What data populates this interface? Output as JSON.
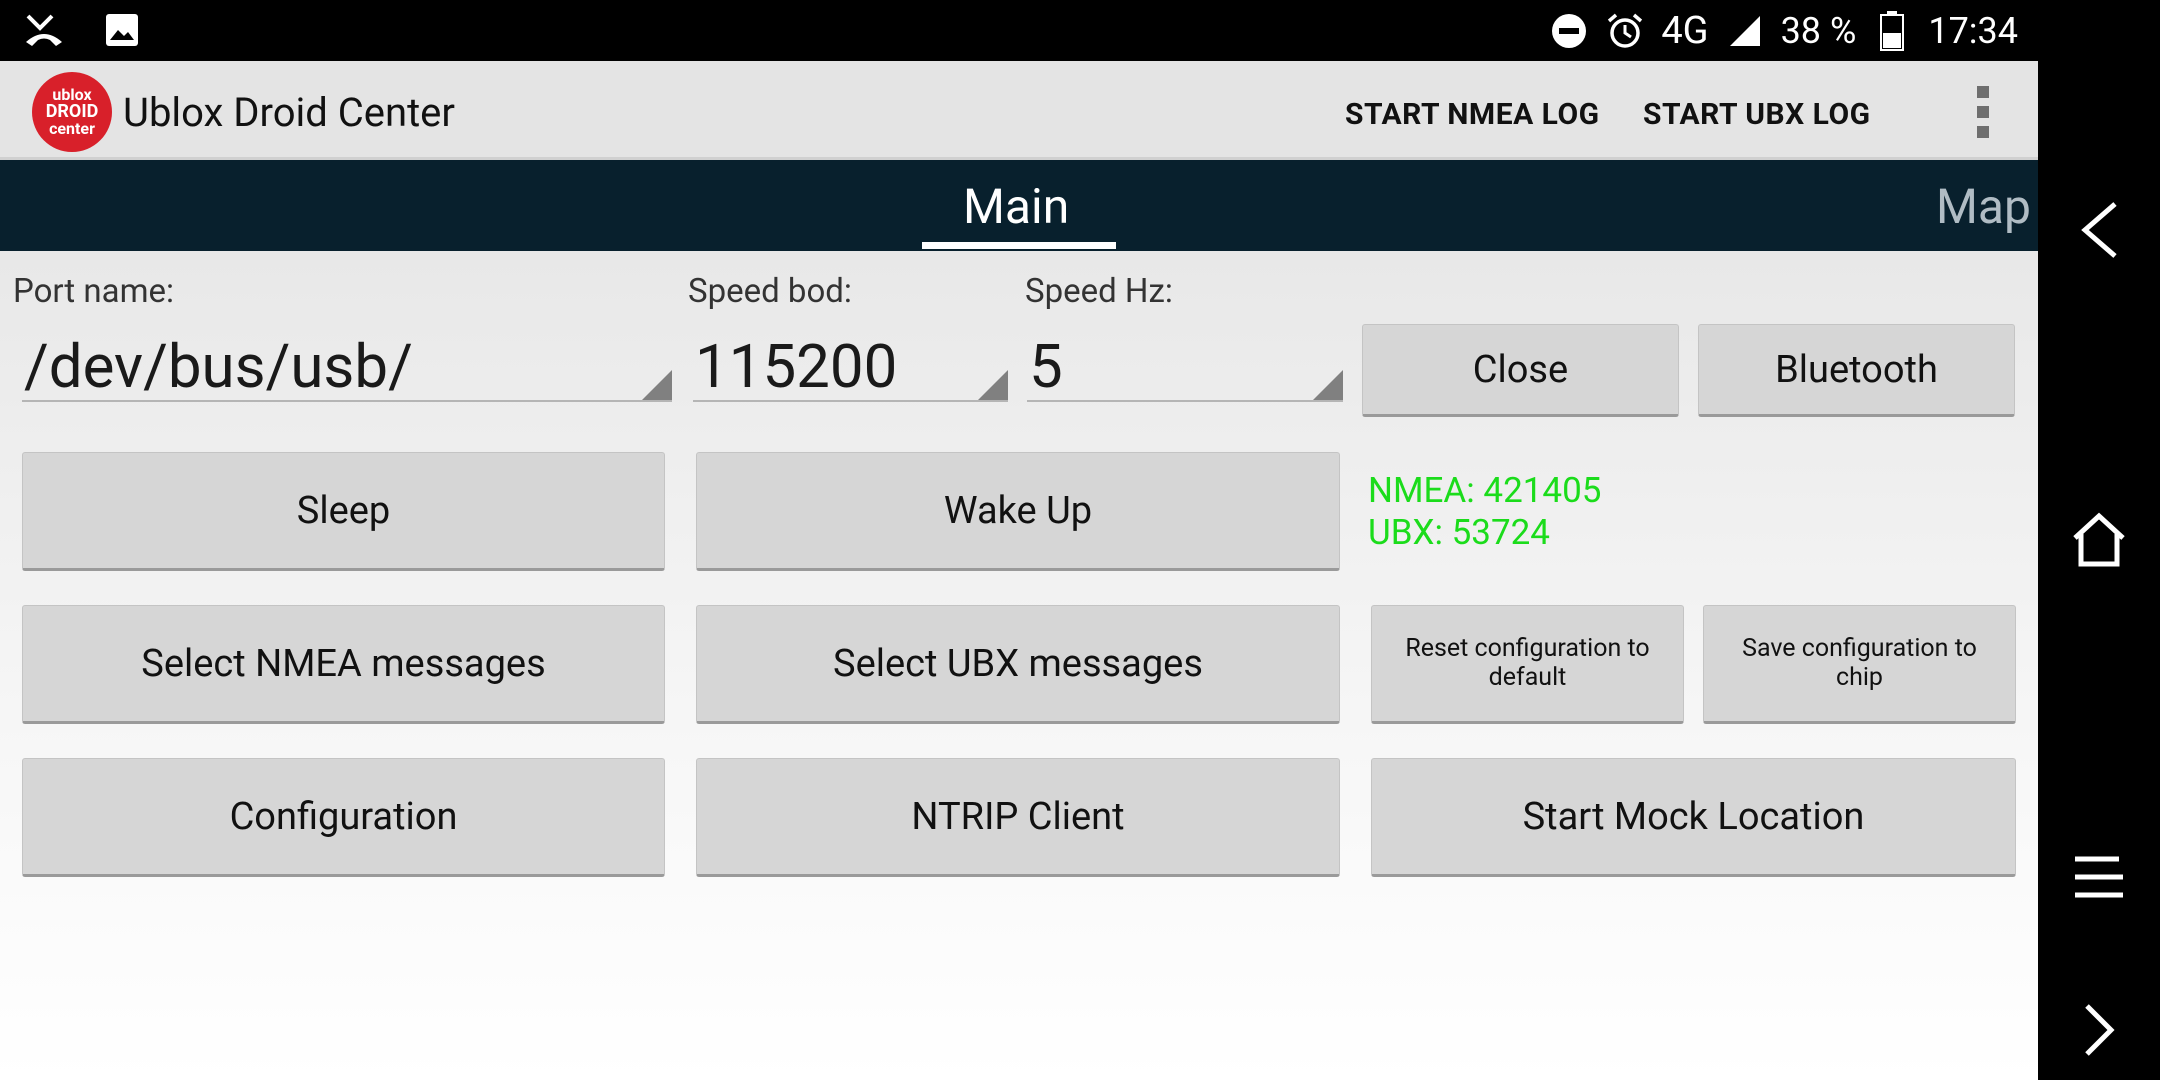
{
  "status_bar": {
    "battery": "38 %",
    "time": "17:34",
    "network": "4G"
  },
  "app_bar": {
    "title": "Ublox Droid Center",
    "logo_text": [
      "ublox",
      "DROID",
      "center"
    ],
    "actions": [
      "START NMEA LOG",
      "START UBX LOG"
    ]
  },
  "tabs": [
    "Main",
    "Map"
  ],
  "settings": {
    "port_label": "Port name:",
    "port_value": "/dev/bus/usb/",
    "speed_bod_label": "Speed bod:",
    "speed_bod_value": "115200",
    "speed_hz_label": "Speed Hz:",
    "speed_hz_value": "5"
  },
  "buttons": {
    "close": "Close",
    "bluetooth": "Bluetooth",
    "sleep": "Sleep",
    "wake_up": "Wake Up",
    "select_nmea": "Select NMEA messages",
    "select_ubx": "Select UBX messages",
    "reset_config": "Reset configuration to default",
    "save_config": "Save configuration to chip",
    "configuration": "Configuration",
    "ntrip_client": "NTRIP Client",
    "start_mock": "Start Mock Location"
  },
  "counters": {
    "nmea": "NMEA: 421405",
    "ubx": "UBX: 53724"
  },
  "colors": {
    "tab_bar": "#08202d",
    "counter_text": "#1bdc1b",
    "logo": "#d8202a"
  }
}
